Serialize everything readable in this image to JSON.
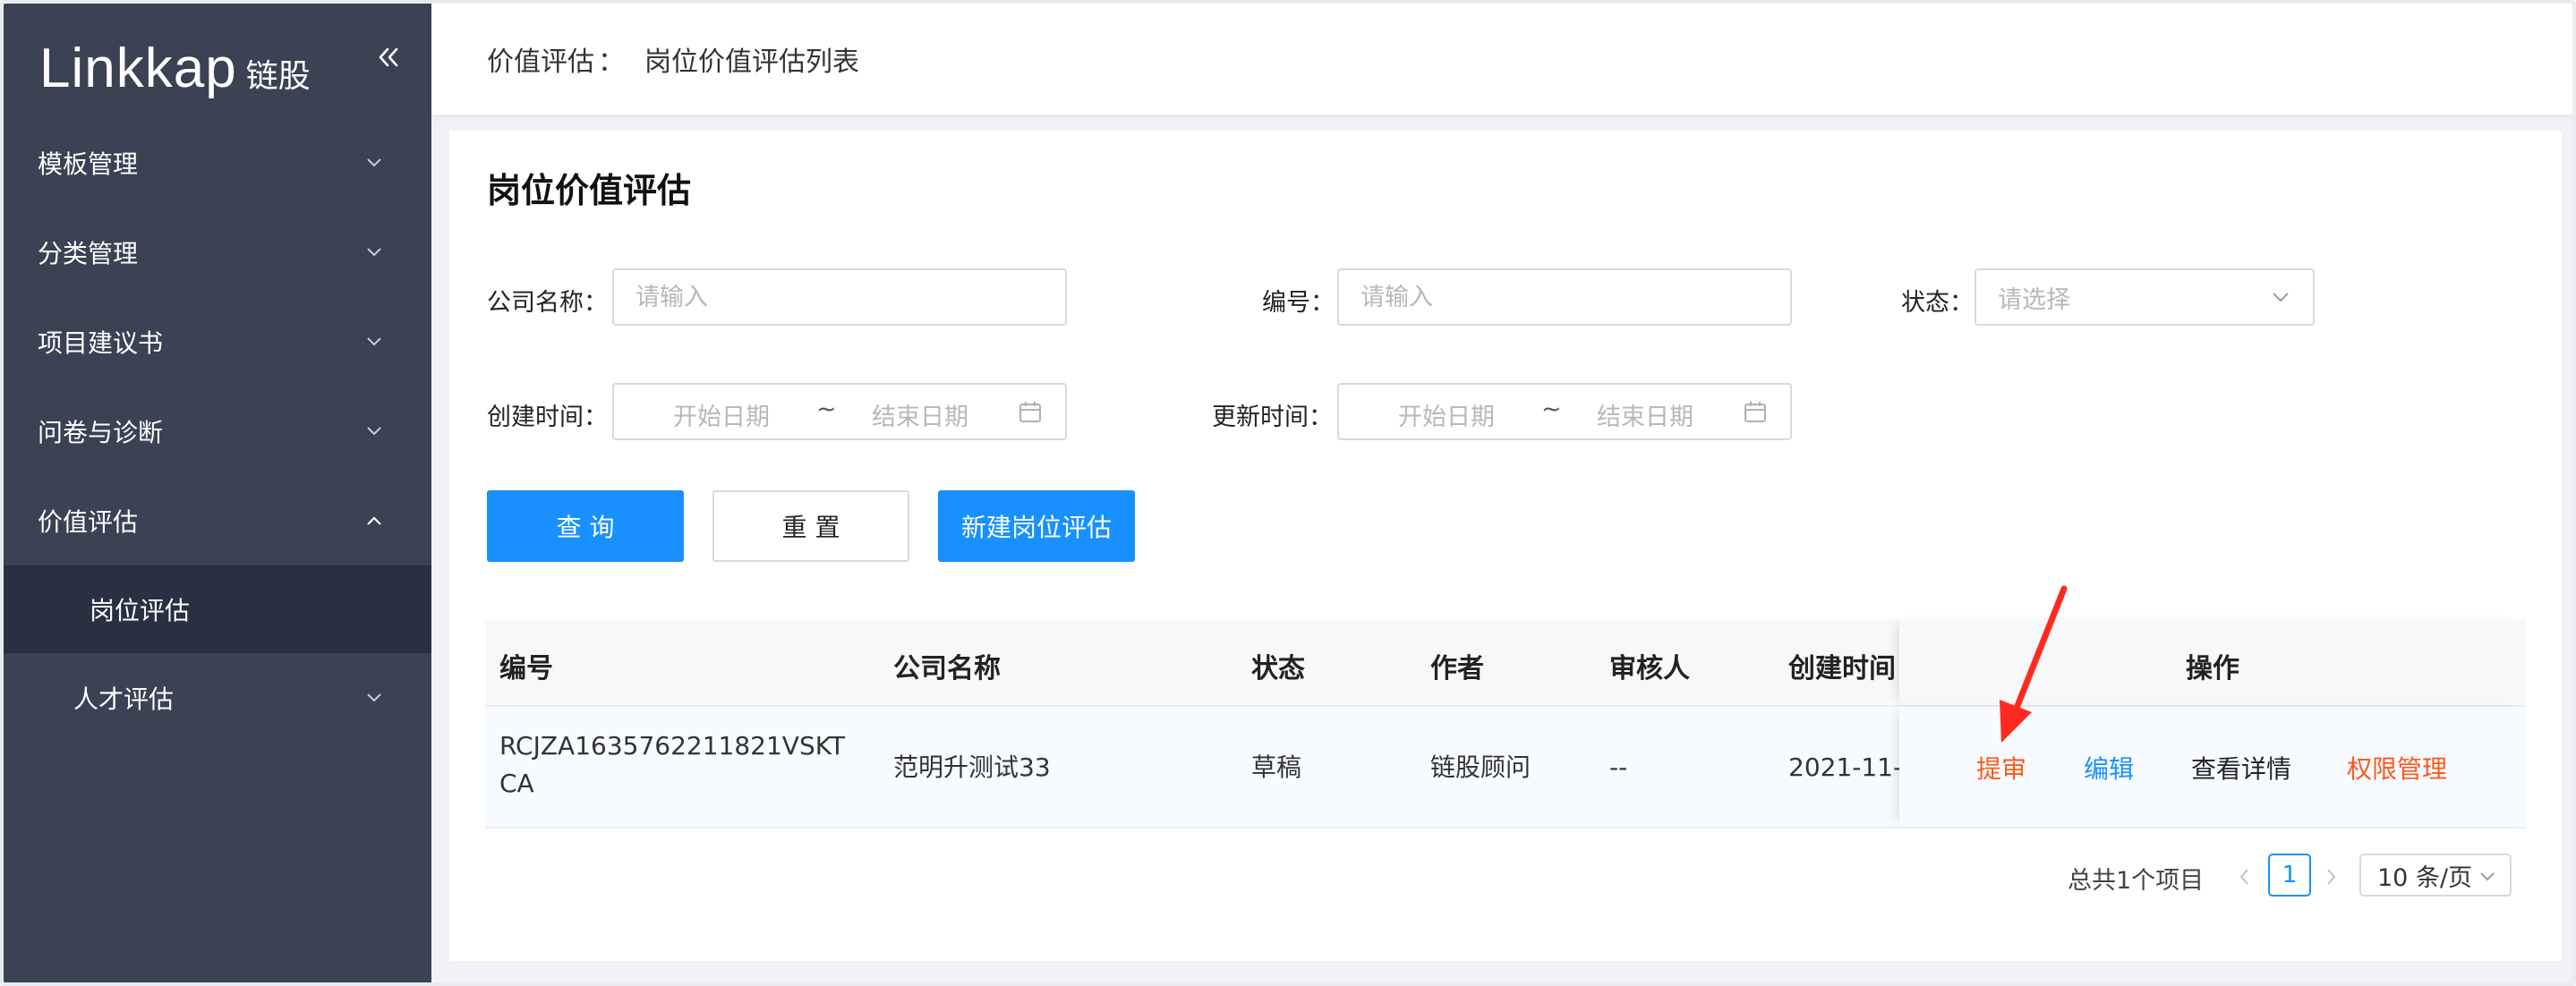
{
  "colors": {
    "sidebar_bg": "#3a4254",
    "sidebar_active_bg": "#283041",
    "primary": "#1890ff",
    "warning": "#fa5a1e",
    "annotation": "#ff2a1f"
  },
  "sidebar": {
    "brand": "Linkkap",
    "brand_cn": "链股",
    "collapse_icon": "double-chevron-left-icon",
    "items": [
      {
        "label": "模板管理",
        "expanded": false
      },
      {
        "label": "分类管理",
        "expanded": false
      },
      {
        "label": "项目建议书",
        "expanded": false
      },
      {
        "label": "问卷与诊断",
        "expanded": false
      },
      {
        "label": "价值评估",
        "expanded": true,
        "children": [
          {
            "label": "岗位评估",
            "active": true
          }
        ]
      },
      {
        "label": "人才评估",
        "expanded": false
      }
    ]
  },
  "header": {
    "breadcrumb_root": "价值评估",
    "breadcrumb_sep": "：",
    "breadcrumb_current": "岗位价值评估列表"
  },
  "main": {
    "title": "岗位价值评估",
    "filters": {
      "company_label": "公司名称：",
      "company_placeholder": "请输入",
      "code_label": "编号：",
      "code_placeholder": "请输入",
      "status_label": "状态：",
      "status_placeholder": "请选择",
      "created_label": "创建时间：",
      "updated_label": "更新时间：",
      "start_placeholder": "开始日期",
      "end_placeholder": "结束日期",
      "range_sep": "~"
    },
    "buttons": {
      "query": "查 询",
      "reset": "重 置",
      "create": "新建岗位评估"
    },
    "table": {
      "columns": [
        "编号",
        "公司名称",
        "状态",
        "作者",
        "审核人",
        "创建时间",
        "操作"
      ],
      "rows": [
        {
          "code_line1": "RCJZA1635762211821VSKT",
          "code_line2": "CA",
          "company": "范明升测试33",
          "status": "草稿",
          "author": "链股顾问",
          "reviewer": "--",
          "created": "2021-11-",
          "actions": {
            "submit": "提审",
            "edit": "编辑",
            "detail": "查看详情",
            "permission": "权限管理"
          }
        }
      ]
    },
    "pagination": {
      "total_text": "总共1个项目",
      "current_page": "1",
      "page_size": "10 条/页"
    }
  }
}
